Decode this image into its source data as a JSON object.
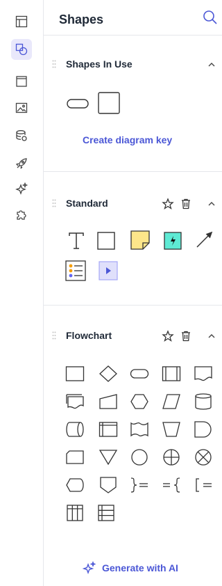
{
  "panel": {
    "title": "Shapes"
  },
  "sections": [
    {
      "title": "Shapes In Use",
      "link": "Create diagram key"
    },
    {
      "title": "Standard"
    },
    {
      "title": "Flowchart"
    }
  ],
  "footer": {
    "generate_label": "Generate with AI"
  },
  "colors": {
    "accent": "#4b57d6",
    "rail_active": "#e9e8fb",
    "note_yellow": "#fde68a",
    "action_teal": "#5eead4",
    "play_lilac": "#e0e0fb"
  },
  "icons": [
    "layout-panels-icon",
    "shapes-icon",
    "window-icon",
    "image-icon",
    "database-link-icon",
    "rocket-icon",
    "sparkle-icon",
    "puzzle-icon",
    "search-icon",
    "grip-icon",
    "chevron-up-icon",
    "star-icon",
    "trash-icon"
  ]
}
